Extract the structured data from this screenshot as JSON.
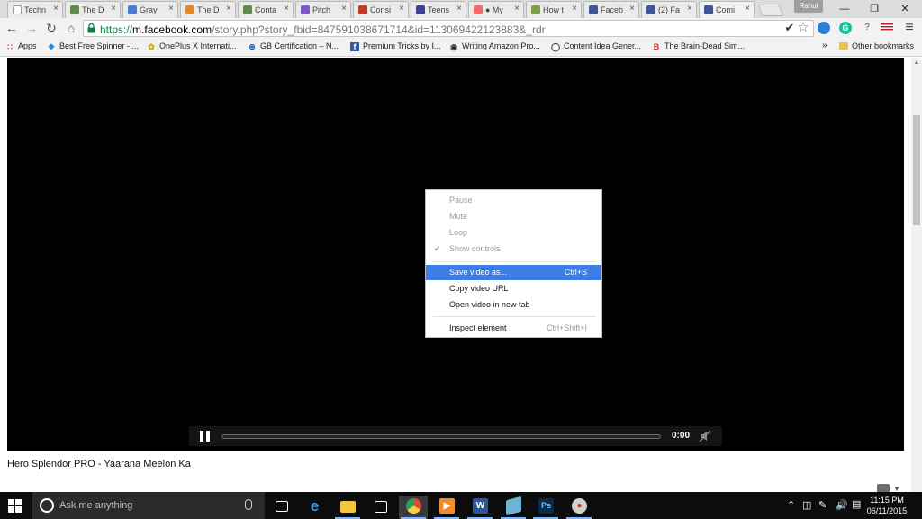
{
  "tabs": [
    {
      "label": "Techn",
      "icon": "page-icon",
      "color": "#ffffff"
    },
    {
      "label": "The D",
      "icon": "h-logo-icon",
      "color": "#5f8a4c"
    },
    {
      "label": "Gray",
      "icon": "grammarly-doc-icon",
      "color": "#4a7fd0"
    },
    {
      "label": "The D",
      "icon": "cube-icon",
      "color": "#e08a2c"
    },
    {
      "label": "Conta",
      "icon": "h-logo-icon",
      "color": "#5f8a4c"
    },
    {
      "label": "Pitch",
      "icon": "calendar-icon",
      "color": "#7e57c2"
    },
    {
      "label": "Consi",
      "icon": "sa-logo-icon",
      "color": "#c0392b"
    },
    {
      "label": "Teens",
      "icon": "n-logo-icon",
      "color": "#3f3f9a"
    },
    {
      "label": "● My",
      "icon": "asana-icon",
      "color": "#f06a6a"
    },
    {
      "label": "How t",
      "icon": "doc-icon",
      "color": "#7aa04b"
    },
    {
      "label": "Faceb",
      "icon": "facebook-icon",
      "color": "#3b5998"
    },
    {
      "label": "(2) Fa",
      "icon": "facebook-icon",
      "color": "#3b5998"
    },
    {
      "label": "Comi",
      "icon": "facebook-icon",
      "color": "#3b5998",
      "active": true
    }
  ],
  "profile": {
    "name": "Rahul"
  },
  "window_controls": {
    "minimize": "—",
    "restore": "❐",
    "close": "✕"
  },
  "toolbar": {
    "back": "←",
    "forward": "→",
    "reload": "↻",
    "home": "⌂",
    "url_scheme": "https://",
    "url_host": "m.facebook.com",
    "url_path": "/story.php?story_fbid=847591038671714&id=113069422123883&_rdr",
    "bookmark_star": "☆",
    "check": "✔",
    "menu": "≡"
  },
  "bookmarks": [
    {
      "label": "Apps",
      "icon": "apps-grid-icon",
      "color": "#e53935"
    },
    {
      "label": "Best Free Spinner - ...",
      "icon": "spinner-icon",
      "color": "#1e88e5"
    },
    {
      "label": "OnePlus X Internati...",
      "icon": "leaf-icon",
      "color": "#c9a400"
    },
    {
      "label": "GB Certification – N...",
      "icon": "gb-logo-icon",
      "color": "#1565c0"
    },
    {
      "label": "Premium Tricks by I...",
      "icon": "facebook-icon",
      "color": "#3b5998"
    },
    {
      "label": "Writing Amazon Pro...",
      "icon": "eye-icon",
      "color": "#333333"
    },
    {
      "label": "Content Idea Gener...",
      "icon": "circle-logo-icon",
      "color": "#333333"
    },
    {
      "label": "The Brain-Dead Sim...",
      "icon": "b-logo-icon",
      "color": "#d32f2f"
    }
  ],
  "bookmarks_more": "»",
  "other_bookmarks": "Other bookmarks",
  "video": {
    "caption": "Hero Splendor PRO - Yaarana Meelon Ka",
    "time": "0:00"
  },
  "context_menu": {
    "items": [
      {
        "label": "Pause",
        "disabled": true
      },
      {
        "label": "Mute",
        "disabled": true
      },
      {
        "label": "Loop",
        "disabled": true
      },
      {
        "label": "Show controls",
        "disabled": true,
        "checked": true
      },
      {
        "label": "Save video as...",
        "shortcut": "Ctrl+S",
        "highlighted": true
      },
      {
        "label": "Copy video URL"
      },
      {
        "label": "Open video in new tab"
      },
      {
        "label": "Inspect element",
        "shortcut": "Ctrl+Shift+I"
      }
    ]
  },
  "taskbar": {
    "search_placeholder": "Ask me anything",
    "apps": [
      {
        "name": "task-view",
        "color": "#0c0c0c"
      },
      {
        "name": "edge",
        "color": "#1e88e5"
      },
      {
        "name": "file-explorer",
        "color": "#f4c542"
      },
      {
        "name": "store",
        "color": "#ffffff"
      },
      {
        "name": "chrome",
        "color": "#dd4b39",
        "active": true
      },
      {
        "name": "media-player",
        "color": "#f28c28"
      },
      {
        "name": "word",
        "color": "#2b579a"
      },
      {
        "name": "notes",
        "color": "#6fb6d6"
      },
      {
        "name": "photoshop",
        "color": "#0a2a4a",
        "text": "Ps"
      },
      {
        "name": "paint",
        "color": "#d0d0d0"
      }
    ],
    "time": "11:15 PM",
    "date": "06/11/2015"
  }
}
